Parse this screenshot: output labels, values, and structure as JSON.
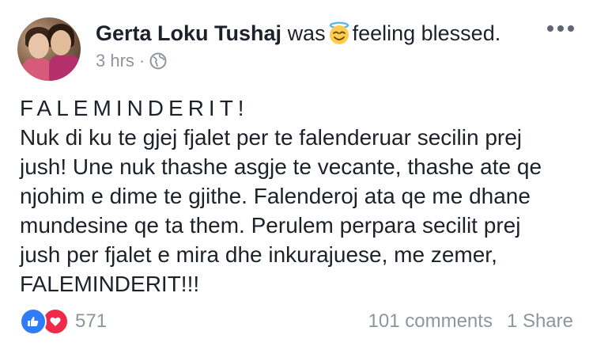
{
  "post": {
    "author": "Gerta Loku Tushaj",
    "action_prefix": "was",
    "activity_icon": "smiling-face-with-halo-icon",
    "feeling": "feeling blessed.",
    "time": "3 hrs",
    "separator": "·",
    "privacy_icon": "globe-icon",
    "body_title": "FALEMINDERIT!",
    "body_lines": [
      "Nuk di ku te gjej fjalet per te falenderuar secilin prej",
      "jush! Une nuk thashe asgje te vecante, thashe ate qe",
      "njohim e dime te gjithe. Falenderoj ata qe me dhane",
      "mundesine qe ta them. Perulem perpara secilit prej",
      "jush per fjalet e mira dhe inkurajuese, me zemer,",
      "FALEMINDERIT!!!"
    ]
  },
  "footer": {
    "reaction_icons": [
      "like-icon",
      "love-icon"
    ],
    "reaction_count": "571",
    "comments": "101 comments",
    "shares": "1 Share"
  },
  "colors": {
    "text": "#1d2129",
    "meta": "#90949c",
    "like": "#2e7cf6",
    "love": "#f0284a"
  }
}
